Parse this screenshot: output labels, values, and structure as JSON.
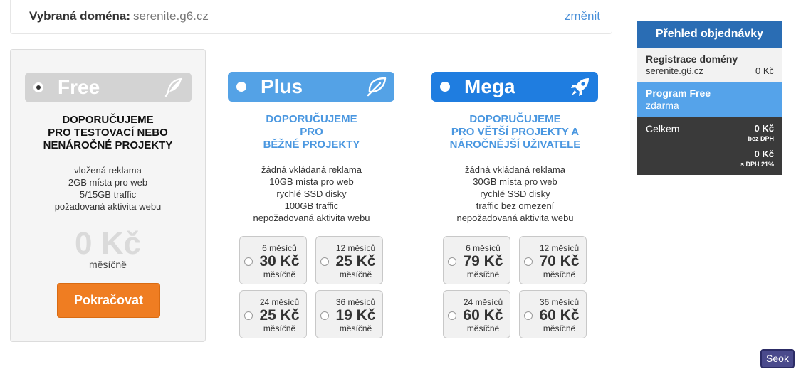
{
  "domain": {
    "label": "Vybraná doména:",
    "value": "serenite.g6.cz",
    "change": "změnit"
  },
  "plans": {
    "free": {
      "name": "Free",
      "icon": "feather-icon",
      "recommend": [
        "DOPORUČUJEME",
        "PRO TESTOVACÍ NEBO",
        "NENÁROČNÉ PROJEKTY"
      ],
      "features": [
        "vložená reklama",
        "2GB místa pro web",
        "5/15GB traffic",
        "požadovaná aktivita webu"
      ],
      "price": "0 Kč",
      "period": "měsíčně",
      "button": "Pokračovat"
    },
    "plus": {
      "name": "Plus",
      "icon": "leaf-icon",
      "recommend": [
        "DOPORUČUJEME",
        "PRO",
        "BĚŽNÉ PROJEKTY"
      ],
      "features": [
        "žádná vkládaná reklama",
        "10GB místa pro web",
        "rychlé SSD disky",
        "100GB traffic",
        "nepožadovaná aktivita webu"
      ],
      "options": [
        {
          "months": "6 měsíců",
          "price": "30 Kč",
          "per": "měsíčně"
        },
        {
          "months": "12 měsíců",
          "price": "25 Kč",
          "per": "měsíčně"
        },
        {
          "months": "24 měsíců",
          "price": "25 Kč",
          "per": "měsíčně"
        },
        {
          "months": "36 měsíců",
          "price": "19 Kč",
          "per": "měsíčně"
        }
      ]
    },
    "mega": {
      "name": "Mega",
      "icon": "rocket-icon",
      "recommend": [
        "DOPORUČUJEME",
        "PRO VĚTŠÍ PROJEKTY A",
        "NÁROČNĚJŠÍ UŽIVATELE"
      ],
      "features": [
        "žádná vkládaná reklama",
        "30GB místa pro web",
        "rychlé SSD disky",
        "traffic bez omezení",
        "nepožadovaná aktivita webu"
      ],
      "options": [
        {
          "months": "6 měsíců",
          "price": "79 Kč",
          "per": "měsíčně"
        },
        {
          "months": "12 měsíců",
          "price": "70 Kč",
          "per": "měsíčně"
        },
        {
          "months": "24 měsíců",
          "price": "60 Kč",
          "per": "měsíčně"
        },
        {
          "months": "36 měsíců",
          "price": "60 Kč",
          "per": "měsíčně"
        }
      ]
    }
  },
  "summary": {
    "title": "Přehled objednávky",
    "registration": {
      "title": "Registrace domény",
      "domain": "serenite.g6.cz",
      "price": "0 Kč"
    },
    "program": {
      "title": "Program Free",
      "value": "zdarma"
    },
    "total": {
      "label": "Celkem",
      "without_vat": "0 Kč",
      "without_vat_label": "bez DPH",
      "with_vat": "0 Kč",
      "with_vat_label": "s DPH 21%"
    }
  },
  "seok_label": "Seok",
  "colors": {
    "free": "#d3d3d3",
    "plus": "#54a2e6",
    "mega": "#1f7de0",
    "accent_orange": "#ef7d22",
    "summary_header": "#2a6db4"
  }
}
